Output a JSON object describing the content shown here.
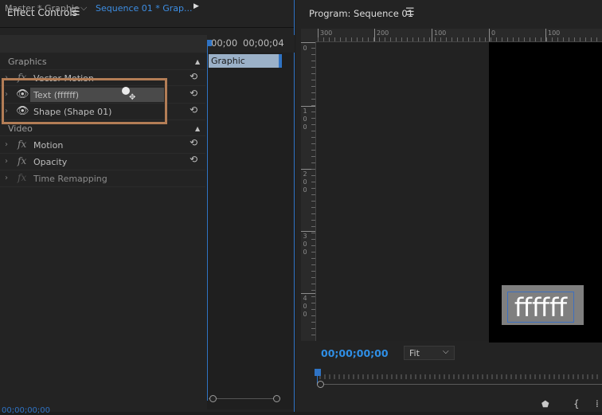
{
  "effect_controls": {
    "title": "Effect Controls",
    "menu_icon": "hamburger-icon",
    "source_label": "Master * Graphic",
    "sequence_label": "Sequence 01 * Grap...",
    "sections": {
      "graphics": "Graphics",
      "video": "Video"
    },
    "effects": [
      {
        "label": "Vector Motion",
        "fx": "fx"
      },
      {
        "label": "Text (ffffff)"
      },
      {
        "label": "Shape (Shape 01)"
      },
      {
        "label": "Motion",
        "fx": "fx"
      },
      {
        "label": "Opacity",
        "fx": "fx"
      },
      {
        "label": "Time Remapping",
        "fx": "fx"
      }
    ],
    "timeline": {
      "time_start": "00;00",
      "time_end": "00;00;04",
      "clip_label": "Graphic"
    },
    "bottom_time": "00;00;00;00",
    "colors": {
      "accent": "#2f73c4",
      "highlight_box": "#b37d56"
    }
  },
  "program": {
    "title": "Program: Sequence 01",
    "menu_icon": "hamburger-icon",
    "ruler_top": [
      "300",
      "200",
      "100",
      "0",
      "100"
    ],
    "ruler_left": [
      [
        "0"
      ],
      [
        "1",
        "0",
        "0"
      ],
      [
        "2",
        "0",
        "0"
      ],
      [
        "3",
        "0",
        "0"
      ],
      [
        "4",
        "0",
        "0"
      ]
    ],
    "frame_text": "ffffff",
    "timecode": "00;00;00;00",
    "zoom": "Fit",
    "colors": {
      "timecode": "#2f8fe6",
      "frame_bg": "#000000",
      "text_box": "#7f7f7f"
    }
  }
}
